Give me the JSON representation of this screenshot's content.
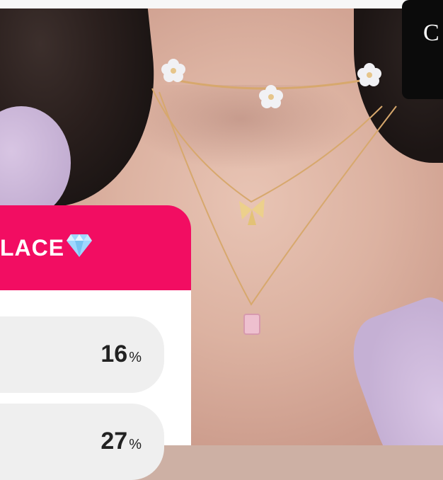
{
  "poll": {
    "title": "LACE",
    "title_icon": "gem-icon",
    "options": [
      {
        "percent": "16",
        "symbol": "%"
      },
      {
        "percent": "27",
        "symbol": "%"
      }
    ]
  },
  "overlay": {
    "corner_glyph": "C"
  },
  "colors": {
    "accent": "#f20d62",
    "option_bg": "#efefef",
    "panel_bg": "#ffffff"
  }
}
